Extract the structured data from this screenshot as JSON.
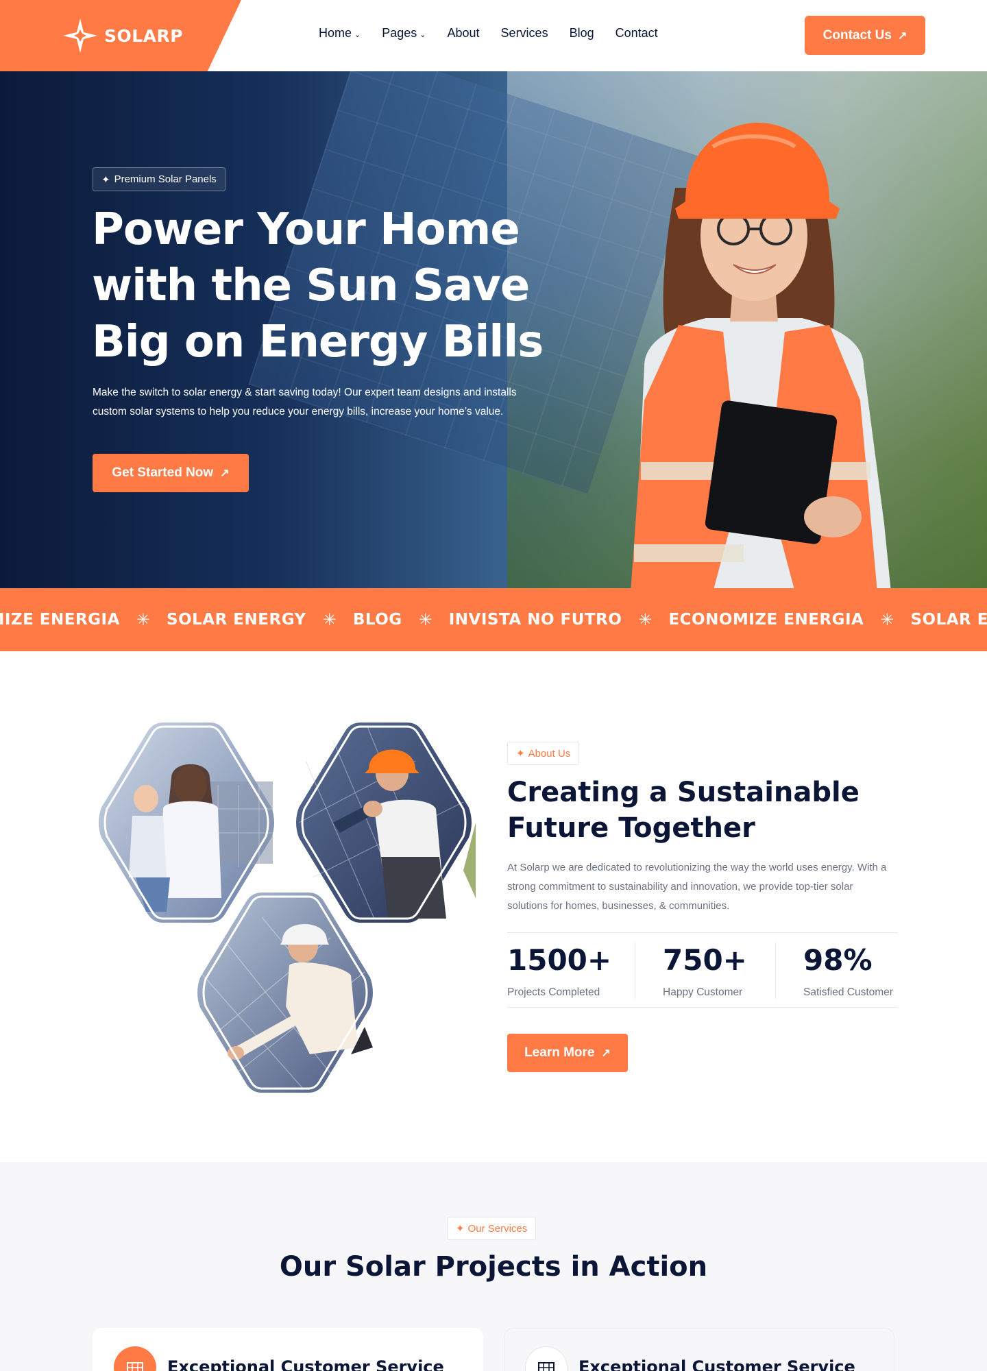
{
  "header": {
    "brand": "SOLARP",
    "nav": [
      {
        "label": "Home",
        "dropdown": true
      },
      {
        "label": "Pages",
        "dropdown": true
      },
      {
        "label": "About",
        "dropdown": false
      },
      {
        "label": "Services",
        "dropdown": false
      },
      {
        "label": "Blog",
        "dropdown": false
      },
      {
        "label": "Contact",
        "dropdown": false
      }
    ],
    "contact_button": "Contact Us"
  },
  "hero": {
    "badge": "Premium Solar Panels",
    "title": "Power Your Home with the Sun Save Big on Energy Bills",
    "description": "Make the switch to solar energy & start saving today! Our expert team designs and installs custom solar systems to help you reduce your energy bills, increase your home’s value.",
    "button": "Get Started Now"
  },
  "marquee": {
    "items": [
      "ECONOMIZE ENERGIA",
      "SOLAR ENERGY",
      "BLOG",
      "INVISTA NO FUTRO",
      "ECONOMIZE ENERGIA",
      "SOLAR ENERGY"
    ]
  },
  "about": {
    "badge": "About Us",
    "title": "Creating a Sustainable Future Together",
    "description": "At Solarp we are dedicated to revolutionizing the way the world uses energy. With  a strong commitment to sustainability and innovation, we provide top-tier solar solutions for homes, businesses, & communities.",
    "stats": [
      {
        "value": "1500+",
        "label": "Projects Completed"
      },
      {
        "value": "750+",
        "label": "Happy Customer"
      },
      {
        "value": "98%",
        "label": "Satisfied Customer"
      }
    ],
    "button": "Learn More"
  },
  "services": {
    "badge": "Our Services",
    "title": "Our Solar Projects in Action",
    "cards": [
      {
        "title": "Exceptional Customer Service",
        "icon": "solar-panel-icon"
      },
      {
        "title": "Exceptional Customer Service",
        "icon": "solar-panel-icon"
      }
    ]
  },
  "colors": {
    "accent": "#ff7a45",
    "dark": "#0b1536",
    "muted": "#6b7180"
  }
}
